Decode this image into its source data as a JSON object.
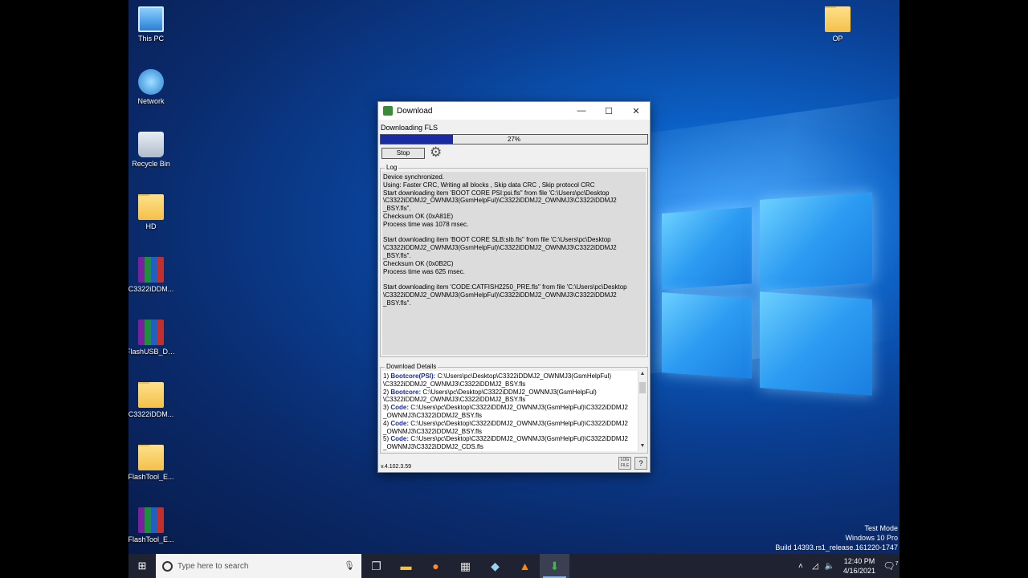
{
  "desktop": {
    "icons_left": [
      {
        "label": "This PC",
        "kind": "pc-icon"
      },
      {
        "label": "Network",
        "kind": "network-icon"
      },
      {
        "label": "Recycle Bin",
        "kind": "recycle-bin-icon"
      },
      {
        "label": "HD",
        "kind": "folder-icon"
      },
      {
        "label": "C3322iDDM...",
        "kind": "winrar-archive-icon"
      },
      {
        "label": "FlashUSB_Dr...",
        "kind": "winrar-archive-icon"
      },
      {
        "label": "C3322iDDM...",
        "kind": "folder-icon"
      },
      {
        "label": "FlashTool_E...",
        "kind": "folder-icon"
      },
      {
        "label": "FlashTool_E...",
        "kind": "winrar-archive-icon"
      }
    ],
    "icons_right": [
      {
        "label": "OP",
        "kind": "folder-icon"
      }
    ]
  },
  "window": {
    "title": "Download",
    "minimize": "—",
    "maximize": "☐",
    "close": "✕",
    "status_label": "Downloading FLS",
    "progress": {
      "percent": 27,
      "text": "27%"
    },
    "stop_label": "Stop",
    "log": {
      "title": "Log",
      "text": "Device synchronized.\nUsing: Faster CRC, Writing all blocks , Skip data CRC , Skip protocol CRC\nStart downloading item 'BOOT CORE PSI:psi.fls\" from file 'C:\\Users\\pc\\Desktop\n\\C3322iDDMJ2_OWNMJ3(GsmHelpFul)\\C3322iDDMJ2_OWNMJ3\\C3322iDDMJ2\n_BSY.fls\".\nChecksum OK (0xA81E)\nProcess time was 1078 msec.\n\nStart downloading item 'BOOT CORE SLB:slb.fls\" from file 'C:\\Users\\pc\\Desktop\n\\C3322iDDMJ2_OWNMJ3(GsmHelpFul)\\C3322iDDMJ2_OWNMJ3\\C3322iDDMJ2\n_BSY.fls\".\nChecksum OK (0x0B2C)\nProcess time was 625 msec.\n\nStart downloading item 'CODE:CATFISH2250_PRE.fls\" from file 'C:\\Users\\pc\\Desktop\n\\C3322iDDMJ2_OWNMJ3(GsmHelpFul)\\C3322iDDMJ2_OWNMJ3\\C3322iDDMJ2\n_BSY.fls\"."
    },
    "details": {
      "title": "Download Details",
      "items": [
        {
          "num": "1)",
          "key": "Bootcore(PSI):",
          "path": "C:\\Users\\pc\\Desktop\\C3322iDDMJ2_OWNMJ3(GsmHelpFul)\n\\C3322iDDMJ2_OWNMJ3\\C3322iDDMJ2_BSY.fls"
        },
        {
          "num": "2)",
          "key": "Bootcore:",
          "path": "C:\\Users\\pc\\Desktop\\C3322iDDMJ2_OWNMJ3(GsmHelpFul)\n\\C3322iDDMJ2_OWNMJ3\\C3322iDDMJ2_BSY.fls"
        },
        {
          "num": "3)",
          "key": "Code:",
          "path": "C:\\Users\\pc\\Desktop\\C3322iDDMJ2_OWNMJ3(GsmHelpFul)\\C3322iDDMJ2\n_OWNMJ3\\C3322iDDMJ2_BSY.fls"
        },
        {
          "num": "4)",
          "key": "Code:",
          "path": "C:\\Users\\pc\\Desktop\\C3322iDDMJ2_OWNMJ3(GsmHelpFul)\\C3322iDDMJ2\n_OWNMJ3\\C3322iDDMJ2_BSY.fls"
        },
        {
          "num": "5)",
          "key": "Code:",
          "path": "C:\\Users\\pc\\Desktop\\C3322iDDMJ2_OWNMJ3(GsmHelpFul)\\C3322iDDMJ2\n_OWNMJ3\\C3322iDDMJ2_CDS.fls"
        }
      ]
    },
    "version": "v.4.102.3.59",
    "log_button": "LOG\nFILE",
    "help_button": "?"
  },
  "watermark": {
    "line1": "Test Mode",
    "line2": "Windows 10 Pro",
    "line3": "Build 14393.rs1_release.161220-1747"
  },
  "taskbar": {
    "search_placeholder": "Type here to search",
    "time": "12:40 PM",
    "date": "4/16/2021",
    "notification_count": "7"
  }
}
